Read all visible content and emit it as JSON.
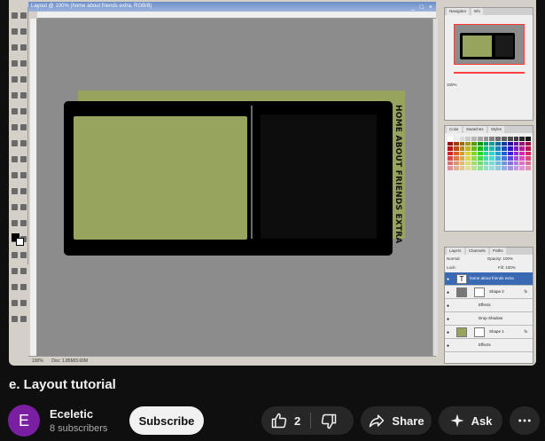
{
  "video": {
    "ps_title": "Layout @ 100% (home about friends extra, RGB/8)",
    "canvas_vertical_text": "HOME ABOUT FRIENDS EXTRA",
    "status": [
      "100%",
      "Doc: 1.85M/3.60M"
    ],
    "panel_tabs": {
      "navigator": [
        "Navigator",
        "Info"
      ],
      "zoom": "100%",
      "swatches": [
        "Color",
        "Swatches",
        "Styles"
      ],
      "layers": [
        "Layers",
        "Channels",
        "Paths"
      ],
      "blend_mode": "Normal",
      "opacity": "Opacity: 100%",
      "fill": "Fill: 100%",
      "lock": "Lock:"
    },
    "layers": [
      {
        "name": "home about friends extra",
        "selected": true,
        "fx": ""
      },
      {
        "name": "Shape 2",
        "selected": false,
        "fx": "fx"
      },
      {
        "name": "Effects",
        "selected": false,
        "fx": ""
      },
      {
        "name": "Drop Shadow",
        "selected": false,
        "fx": ""
      },
      {
        "name": "Shape 1",
        "selected": false,
        "fx": "fx"
      },
      {
        "name": "Effects",
        "selected": false,
        "fx": ""
      }
    ],
    "colors": {
      "canvas_bg": "#8c8c8c",
      "green": "#97a45e",
      "black": "#000000",
      "layer_selected": "#3b6ab4"
    }
  },
  "title": "e. Layout tutorial",
  "channel": {
    "avatar_letter": "E",
    "name": "Eceletic",
    "subscribers": "8 subscribers",
    "avatar_color": "#7b1fa2"
  },
  "actions": {
    "subscribe": "Subscribe",
    "like_count": "2",
    "share": "Share",
    "ask": "Ask"
  }
}
